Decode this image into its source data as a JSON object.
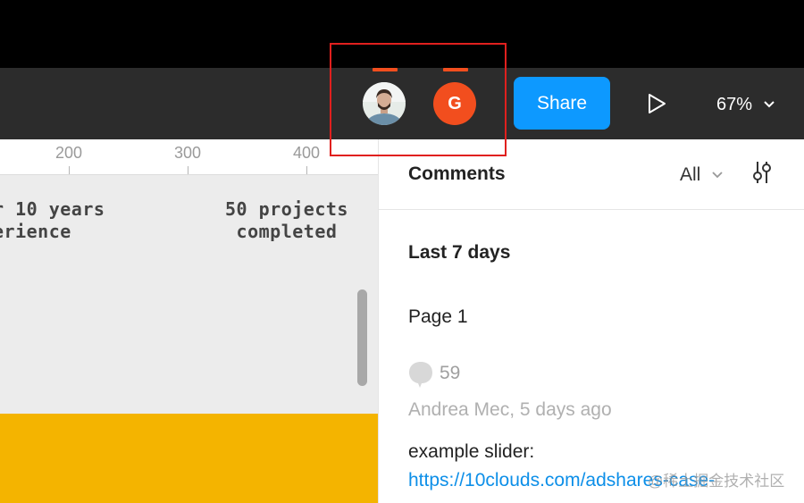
{
  "toolbar": {
    "collaborators": [
      {
        "name": "photo-user",
        "indicator_color": "#f24e1e"
      },
      {
        "initial": "G",
        "avatar_color": "#f24e1e",
        "indicator_color": "#f24e1e"
      }
    ],
    "share_label": "Share",
    "play_icon": "play-icon",
    "zoom_label": "67%",
    "highlight_color": "#e0201e"
  },
  "canvas": {
    "ruler": {
      "ticks": [
        "200",
        "300",
        "400"
      ]
    },
    "text_left": "r 10 years\nerience",
    "text_right": "50 projects\n completed",
    "banner_color": "#f4b400"
  },
  "comments_panel": {
    "title": "Comments",
    "filter_label": "All",
    "section_title": "Last 7 days",
    "page_title": "Page 1",
    "comment_count": "59",
    "author_line": "Andrea Mec, 5 days ago",
    "comment_text": "example slider:",
    "comment_link": "https://10clouds.com/adshares-case-"
  },
  "watermark": "@稀土掘金技术社区"
}
